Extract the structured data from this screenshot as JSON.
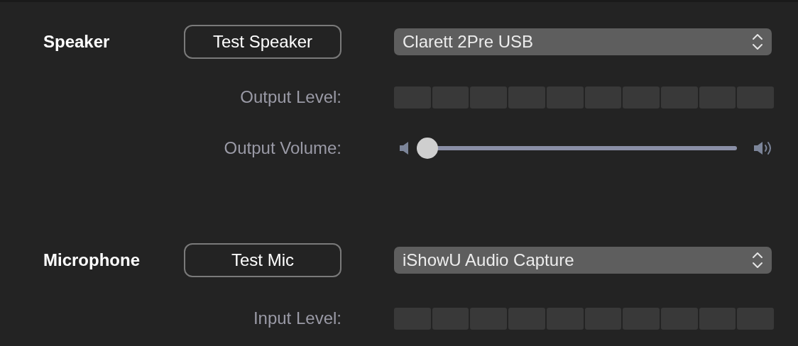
{
  "sections": [
    {
      "title": "Speaker",
      "test_button": "Test Speaker",
      "device": "Clarett 2Pre USB",
      "rows": [
        {
          "kind": "meter",
          "label": "Output Level:"
        },
        {
          "kind": "slider",
          "label": "Output Volume:",
          "level": 0
        }
      ]
    },
    {
      "title": "Microphone",
      "test_button": "Test Mic",
      "device": "iShowU Audio Capture",
      "rows": [
        {
          "kind": "meter",
          "label": "Input Level:"
        }
      ]
    }
  ]
}
